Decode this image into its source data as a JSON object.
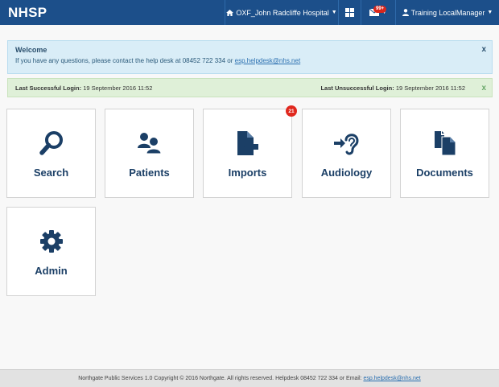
{
  "navbar": {
    "brand": "NHSP",
    "hospital": "OXF_John Radcliffe Hospital",
    "messages_badge": "99+",
    "user": "Training LocalManager",
    "icons": {
      "hospital": "home-icon",
      "grid": "grid-icon",
      "messages": "envelope-icon",
      "user": "user-icon"
    }
  },
  "welcome": {
    "title": "Welcome",
    "text": "If you have any questions, please contact the help desk at 08452 722 334 or",
    "email": "esp.helpdesk@nhs.net",
    "close": "x"
  },
  "login": {
    "success_label": "Last Successful Login:",
    "success_value": "19 September 2016 11:52",
    "fail_label": "Last Unsuccessful Login:",
    "fail_value": "19 September 2016 11:52",
    "close": "x"
  },
  "tiles": [
    {
      "label": "Search",
      "icon": "search-icon"
    },
    {
      "label": "Patients",
      "icon": "users-icon"
    },
    {
      "label": "Imports",
      "icon": "import-file-icon",
      "badge": "21"
    },
    {
      "label": "Audiology",
      "icon": "ear-icon"
    },
    {
      "label": "Documents",
      "icon": "documents-icon"
    },
    {
      "label": "Admin",
      "icon": "gear-icon"
    }
  ],
  "footer": {
    "text": "Northgate Public Services 1.0 Copyright © 2016 Northgate. All rights reserved. Helpdesk 08452 722 334 or Email:",
    "email": "esp.helpdesk@nhs.net"
  },
  "colors": {
    "navbar": "#1c4f8a",
    "tile_icon": "#1b3f66",
    "info_alert": "#d9edf7",
    "success_alert": "#dff0d8",
    "badge": "#e0281e"
  }
}
